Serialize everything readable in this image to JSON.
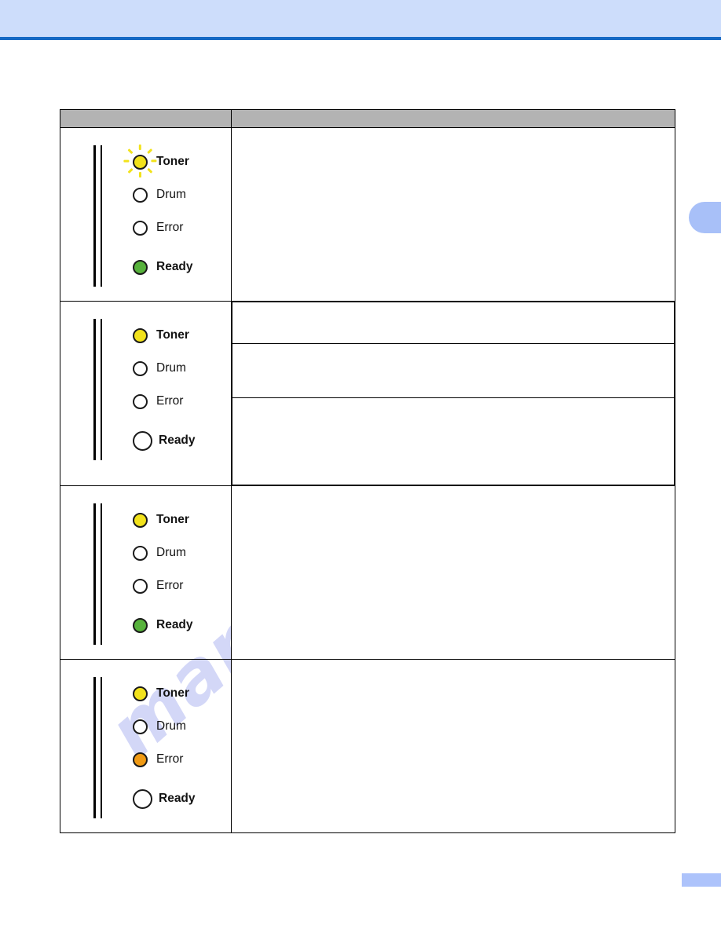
{
  "page": {
    "header_band_color": "#cdddfb",
    "header_rule_color": "#1669c4",
    "side_tab_color": "#a8c0f8",
    "footer_marker_color": "#adc3fb",
    "watermark_text": "manualshive.com",
    "watermark_color": "#c3c8f4"
  },
  "colors": {
    "led_yellow": "#f2e21b",
    "led_green": "#57b23c",
    "led_orange": "#f09a14",
    "led_off": "#ffffff",
    "led_outline": "#1a1a1a",
    "table_header_gray": "#b3b3b3",
    "table_border": "#000000"
  },
  "table": {
    "header": {
      "panel_column_label": "",
      "description_column_label": ""
    },
    "rows": [
      {
        "row_id": "row-1",
        "panel": {
          "leds": [
            {
              "name": "Toner",
              "state": "blinking",
              "color": "#f2e21b",
              "size": "normal",
              "bold_label": true
            },
            {
              "name": "Drum",
              "state": "off",
              "color": "#ffffff",
              "size": "normal",
              "bold_label": false
            },
            {
              "name": "Error",
              "state": "off",
              "color": "#ffffff",
              "size": "normal",
              "bold_label": false
            },
            {
              "name": "Ready",
              "state": "on",
              "color": "#57b23c",
              "size": "normal",
              "bold_label": true
            }
          ]
        },
        "description_subrows": [
          ""
        ]
      },
      {
        "row_id": "row-2",
        "panel": {
          "leds": [
            {
              "name": "Toner",
              "state": "on",
              "color": "#f2e21b",
              "size": "normal",
              "bold_label": true
            },
            {
              "name": "Drum",
              "state": "off",
              "color": "#ffffff",
              "size": "normal",
              "bold_label": false
            },
            {
              "name": "Error",
              "state": "off",
              "color": "#ffffff",
              "size": "normal",
              "bold_label": false
            },
            {
              "name": "Ready",
              "state": "off",
              "color": "#ffffff",
              "size": "big",
              "bold_label": true
            }
          ]
        },
        "description_subrows": [
          "",
          "",
          ""
        ]
      },
      {
        "row_id": "row-3",
        "panel": {
          "leds": [
            {
              "name": "Toner",
              "state": "on",
              "color": "#f2e21b",
              "size": "normal",
              "bold_label": true
            },
            {
              "name": "Drum",
              "state": "off",
              "color": "#ffffff",
              "size": "normal",
              "bold_label": false
            },
            {
              "name": "Error",
              "state": "off",
              "color": "#ffffff",
              "size": "normal",
              "bold_label": false
            },
            {
              "name": "Ready",
              "state": "on",
              "color": "#57b23c",
              "size": "normal",
              "bold_label": true
            }
          ]
        },
        "description_subrows": [
          ""
        ]
      },
      {
        "row_id": "row-4",
        "panel": {
          "leds": [
            {
              "name": "Toner",
              "state": "on",
              "color": "#f2e21b",
              "size": "normal",
              "bold_label": true
            },
            {
              "name": "Drum",
              "state": "off",
              "color": "#ffffff",
              "size": "normal",
              "bold_label": false
            },
            {
              "name": "Error",
              "state": "on",
              "color": "#f09a14",
              "size": "normal",
              "bold_label": false
            },
            {
              "name": "Ready",
              "state": "off",
              "color": "#ffffff",
              "size": "big",
              "bold_label": true
            }
          ]
        },
        "description_subrows": [
          ""
        ]
      }
    ]
  }
}
